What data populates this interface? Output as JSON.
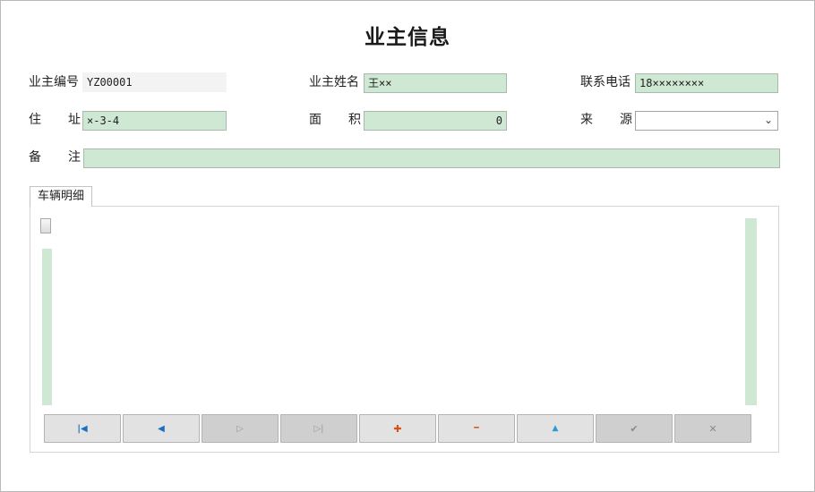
{
  "form": {
    "title": "业主信息"
  },
  "fields": {
    "owner_id": {
      "label": "业主编号",
      "value": "YZ00001"
    },
    "owner_name": {
      "label": "业主姓名",
      "value": "王××"
    },
    "phone": {
      "label": "联系电话",
      "value": "18××××××××"
    },
    "address": {
      "label_chars": [
        "住",
        "址"
      ],
      "value": "×-3-4"
    },
    "area": {
      "label_chars": [
        "面",
        "积"
      ],
      "value": "0"
    },
    "source": {
      "label_chars": [
        "来",
        "源"
      ],
      "value": ""
    },
    "remarks": {
      "label_chars": [
        "备",
        "注"
      ],
      "value": ""
    }
  },
  "tabs": [
    {
      "label": "车辆明细"
    }
  ],
  "navigator": {
    "buttons": [
      {
        "name": "first-record-button",
        "icon": "first-icon",
        "glyph": "|◀",
        "color": "#1a6fc2",
        "enabled": true
      },
      {
        "name": "prev-record-button",
        "icon": "prev-icon",
        "glyph": "◀",
        "color": "#1a6fc2",
        "enabled": true
      },
      {
        "name": "next-record-button",
        "icon": "next-icon",
        "glyph": "▷",
        "color": "#9a9a9a",
        "enabled": false
      },
      {
        "name": "last-record-button",
        "icon": "last-icon",
        "glyph": "▷|",
        "color": "#9a9a9a",
        "enabled": false
      },
      {
        "name": "add-record-button",
        "icon": "plus-icon",
        "glyph": "✚",
        "color": "#d4531a",
        "enabled": true
      },
      {
        "name": "delete-record-button",
        "icon": "minus-icon",
        "glyph": "━",
        "color": "#d4531a",
        "enabled": true
      },
      {
        "name": "edit-record-button",
        "icon": "up-triangle-icon",
        "glyph": "▲",
        "color": "#2a9ad4",
        "enabled": true
      },
      {
        "name": "post-record-button",
        "icon": "check-icon",
        "glyph": "✔",
        "color": "#8a8a8a",
        "enabled": false
      },
      {
        "name": "cancel-record-button",
        "icon": "close-icon",
        "glyph": "✕",
        "color": "#8a8a8a",
        "enabled": false
      }
    ]
  },
  "colors": {
    "field_bg": "#cfe8d3",
    "readonly_bg": "#f3f3f3"
  }
}
